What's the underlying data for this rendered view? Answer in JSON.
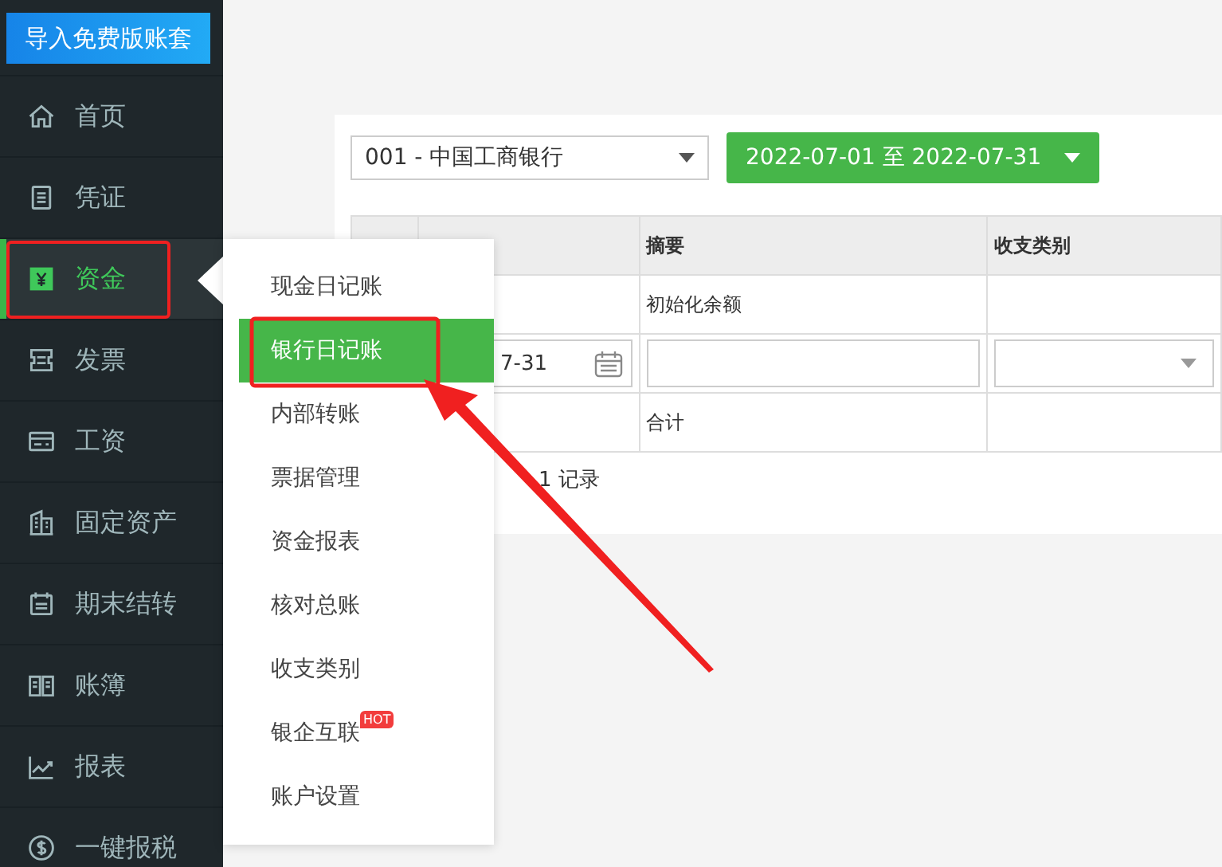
{
  "import_button": {
    "label": "导入免费版账套"
  },
  "sidebar": {
    "items": [
      {
        "label": "首页",
        "selected": false
      },
      {
        "label": "凭证",
        "selected": false
      },
      {
        "label": "资金",
        "selected": true
      },
      {
        "label": "发票",
        "selected": false
      },
      {
        "label": "工资",
        "selected": false
      },
      {
        "label": "固定资产",
        "selected": false
      },
      {
        "label": "期末结转",
        "selected": false
      },
      {
        "label": "账簿",
        "selected": false
      },
      {
        "label": "报表",
        "selected": false
      },
      {
        "label": "一键报税",
        "selected": false
      }
    ]
  },
  "submenu": {
    "items": [
      {
        "label": "现金日记账",
        "selected": false
      },
      {
        "label": "银行日记账",
        "selected": true
      },
      {
        "label": "内部转账",
        "selected": false
      },
      {
        "label": "票据管理",
        "selected": false
      },
      {
        "label": "资金报表",
        "selected": false
      },
      {
        "label": "核对总账",
        "selected": false
      },
      {
        "label": "收支类别",
        "selected": false
      },
      {
        "label": "银企互联",
        "selected": false,
        "badge": "HOT"
      },
      {
        "label": "账户设置",
        "selected": false
      }
    ]
  },
  "toolbar": {
    "account_select": {
      "value": "001 - 中国工商银行"
    },
    "period_button": {
      "label": "2022-07-01 至 2022-07-31"
    }
  },
  "table": {
    "headers": [
      "摘要",
      "收支类别"
    ],
    "rows": [
      {
        "kind": "text",
        "summary": "初始化余额"
      },
      {
        "kind": "edit",
        "date": "7-31"
      },
      {
        "kind": "text",
        "summary": "合计"
      }
    ],
    "footer": "1 记录"
  }
}
